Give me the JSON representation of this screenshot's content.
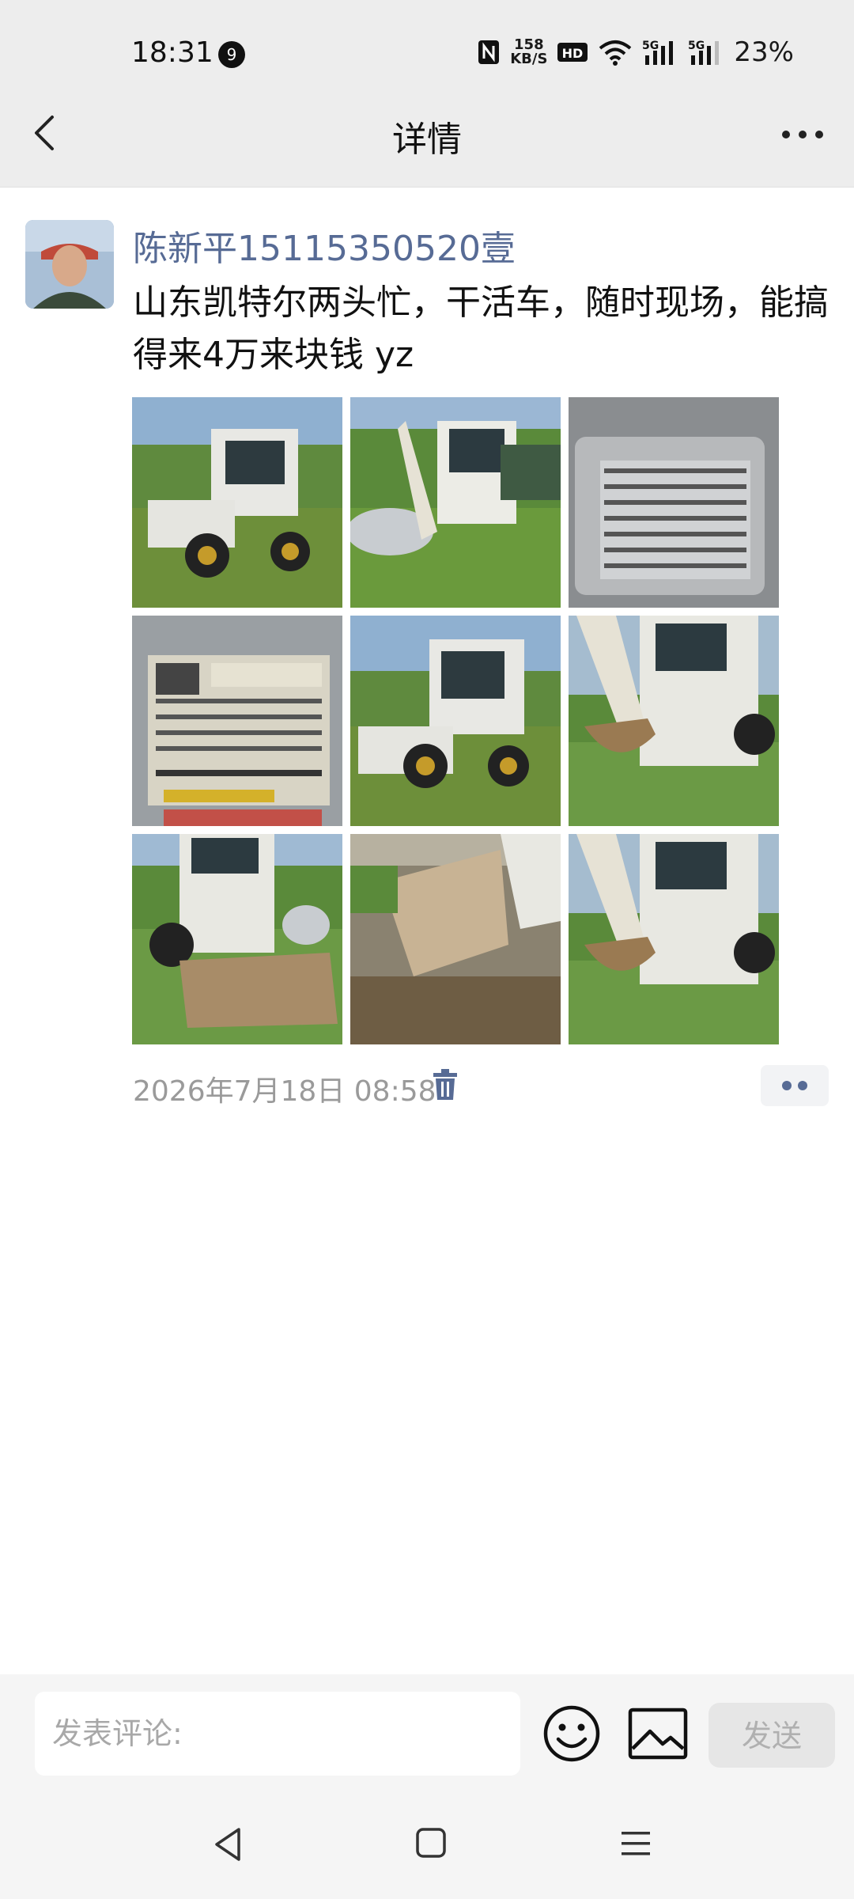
{
  "status_bar": {
    "time": "18:31",
    "notification_count": "9",
    "net_speed_value": "158",
    "net_speed_unit": "KB/S",
    "battery": "23%",
    "icons": [
      "nfc-icon",
      "hd-icon",
      "wifi-icon",
      "5g-signal-icon",
      "5g-signal-icon"
    ]
  },
  "header": {
    "title": "详情",
    "back_icon": "chevron-left-icon",
    "more_icon": "more-dots-icon"
  },
  "post": {
    "author": "陈新平15115350520壹",
    "text": "山东凯特尔两头忙，干活车，随时现场，能搞得来4万来块钱 yz",
    "time": "2026年7月18日 08:58",
    "image_count": 9,
    "accent_color": "#576b95"
  },
  "comment_bar": {
    "placeholder": "发表评论:",
    "send_label": "发送"
  },
  "nav_bar": {
    "icons": [
      "nav-back-icon",
      "nav-home-icon",
      "nav-menu-icon"
    ]
  }
}
